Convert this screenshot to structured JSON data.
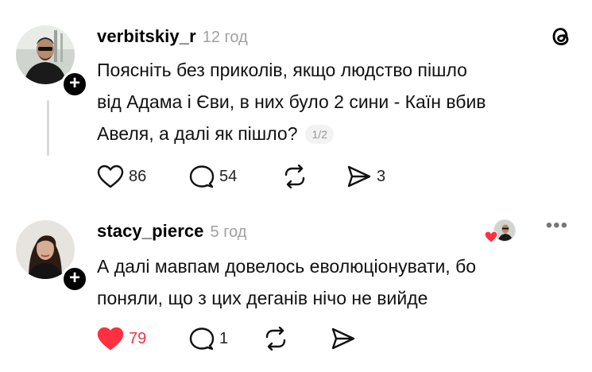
{
  "posts": [
    {
      "username": "verbitskiy_r",
      "time": "12 год",
      "text_lines": [
        "Поясніть без приколів, якщо людство пішло",
        "від Адама і Єви, в них було 2 сини - Каїн вбив",
        "Авеля, а далі як пішло?"
      ],
      "page_indicator": "1/2",
      "likes": "86",
      "replies": "54",
      "shares": "3"
    },
    {
      "username": "stacy_pierce",
      "time": "5 год",
      "text_lines": [
        "А далі мавпам довелось еволюціонувати, бо",
        "поняли, що з цих деганів нічо не вийде"
      ],
      "likes": "79",
      "replies": "1",
      "more": "•••"
    }
  ],
  "icons": {
    "app_logo": "threads-logo-icon",
    "follow_badge": "plus-icon",
    "like": "heart-icon",
    "reply": "comment-icon",
    "repost": "repost-icon",
    "share": "send-icon"
  },
  "colors": {
    "like_active": "#ff3040",
    "muted_text": "#a0a0a0",
    "thread_line": "#d9d9d9"
  }
}
